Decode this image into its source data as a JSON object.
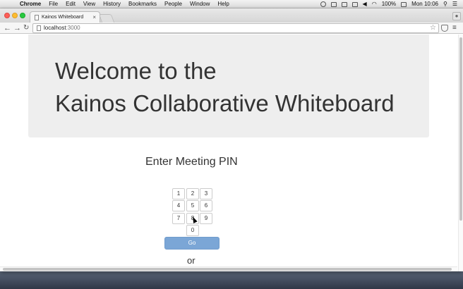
{
  "menubar": {
    "app_name": "Chrome",
    "items": [
      "File",
      "Edit",
      "View",
      "History",
      "Bookmarks",
      "People",
      "Window",
      "Help"
    ],
    "battery": "100%",
    "clock": "Mon 10:06"
  },
  "browser": {
    "tab_title": "Kainos Whiteboard",
    "tab_close": "×",
    "url_host": "localhost",
    "url_port": ":3000"
  },
  "page": {
    "heading_line1": "Welcome to the",
    "heading_line2": "Kainos Collaborative Whiteboard",
    "pin_heading": "Enter Meeting PIN",
    "keypad": [
      "1",
      "2",
      "3",
      "4",
      "5",
      "6",
      "7",
      "8",
      "9",
      "0"
    ],
    "go_label": "Go",
    "or_label": "or"
  },
  "icons": {
    "apple": "apple-logo-icon",
    "back": "back-arrow-icon",
    "forward": "forward-arrow-icon",
    "reload": "reload-icon",
    "star": "bookmark-star-icon",
    "menu": "hamburger-menu-icon"
  },
  "colors": {
    "primary": "#337ab7",
    "go_disabled": "#7ba6d6",
    "jumbotron": "#eeeeee"
  }
}
